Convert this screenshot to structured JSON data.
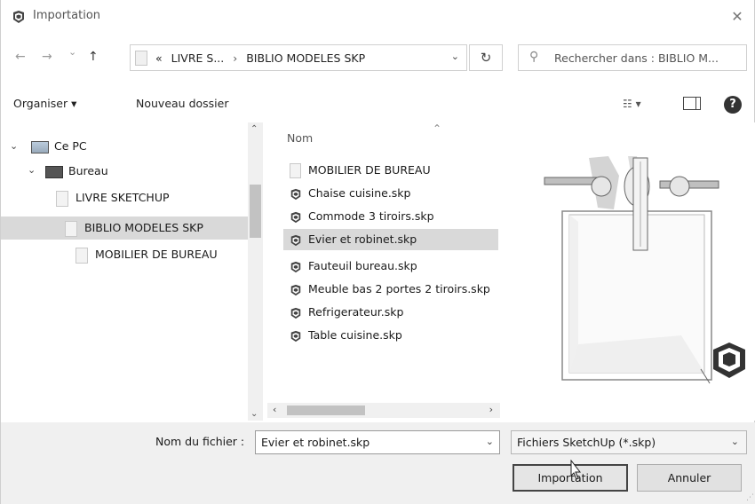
{
  "window": {
    "title": "Importation",
    "close_glyph": "✕"
  },
  "address_bar": {
    "back_glyph": "←",
    "forward_glyph": "→",
    "recent_glyph": "⌄",
    "up_glyph": "↑",
    "overflow_glyph": "«",
    "crumb_1": "LIVRE S...",
    "crumb_sep": "›",
    "crumb_2": "BIBLIO MODELES SKP",
    "dropdown_glyph": "⌄",
    "refresh_glyph": "↻"
  },
  "search": {
    "placeholder": "Rechercher dans : BIBLIO M...",
    "icon": "search-icon"
  },
  "toolbar": {
    "organize_label": "Organiser ▾",
    "new_folder_label": "Nouveau dossier",
    "view_label": "☷ ▾",
    "help_label": "?"
  },
  "nav_tree": {
    "items": [
      {
        "label": "Ce PC",
        "icon": "computer-icon"
      },
      {
        "label": "Bureau",
        "icon": "desktop-icon"
      },
      {
        "label": "LIVRE SKETCHUP",
        "icon": "folder-icon"
      },
      {
        "label": "BIBLIO MODELES SKP",
        "icon": "folder-icon",
        "selected": true
      },
      {
        "label": "MOBILIER DE BUREAU",
        "icon": "folder-icon"
      }
    ],
    "expand_glyph": "⌄",
    "scroll_up": "⌃",
    "scroll_down": "⌄"
  },
  "file_list": {
    "column_name": "Nom",
    "sort_glyph": "⌃",
    "items": [
      {
        "name": "MOBILIER DE BUREAU",
        "type": "folder"
      },
      {
        "name": "Chaise cuisine.skp",
        "type": "skp"
      },
      {
        "name": "Commode 3 tiroirs.skp",
        "type": "skp"
      },
      {
        "name": "Evier et robinet.skp",
        "type": "skp",
        "selected": true
      },
      {
        "name": "Fauteuil bureau.skp",
        "type": "skp"
      },
      {
        "name": "Meuble bas 2 portes 2 tiroirs.skp",
        "type": "skp"
      },
      {
        "name": "Refrigerateur.skp",
        "type": "skp"
      },
      {
        "name": "Table cuisine.skp",
        "type": "skp"
      }
    ],
    "scroll_left": "‹",
    "scroll_right": "›"
  },
  "bottom": {
    "filename_label": "Nom du fichier :",
    "filename_value": "Evier et robinet.skp",
    "filetype_value": "Fichiers SketchUp (*.skp)",
    "dropdown_glyph": "⌄",
    "import_label": "Importation",
    "cancel_label": "Annuler",
    "grip_glyph": "⋰"
  },
  "colors": {
    "selection": "#d9d9d9",
    "bottom_bar": "#f0f0f0",
    "border": "#d0d0d0"
  }
}
